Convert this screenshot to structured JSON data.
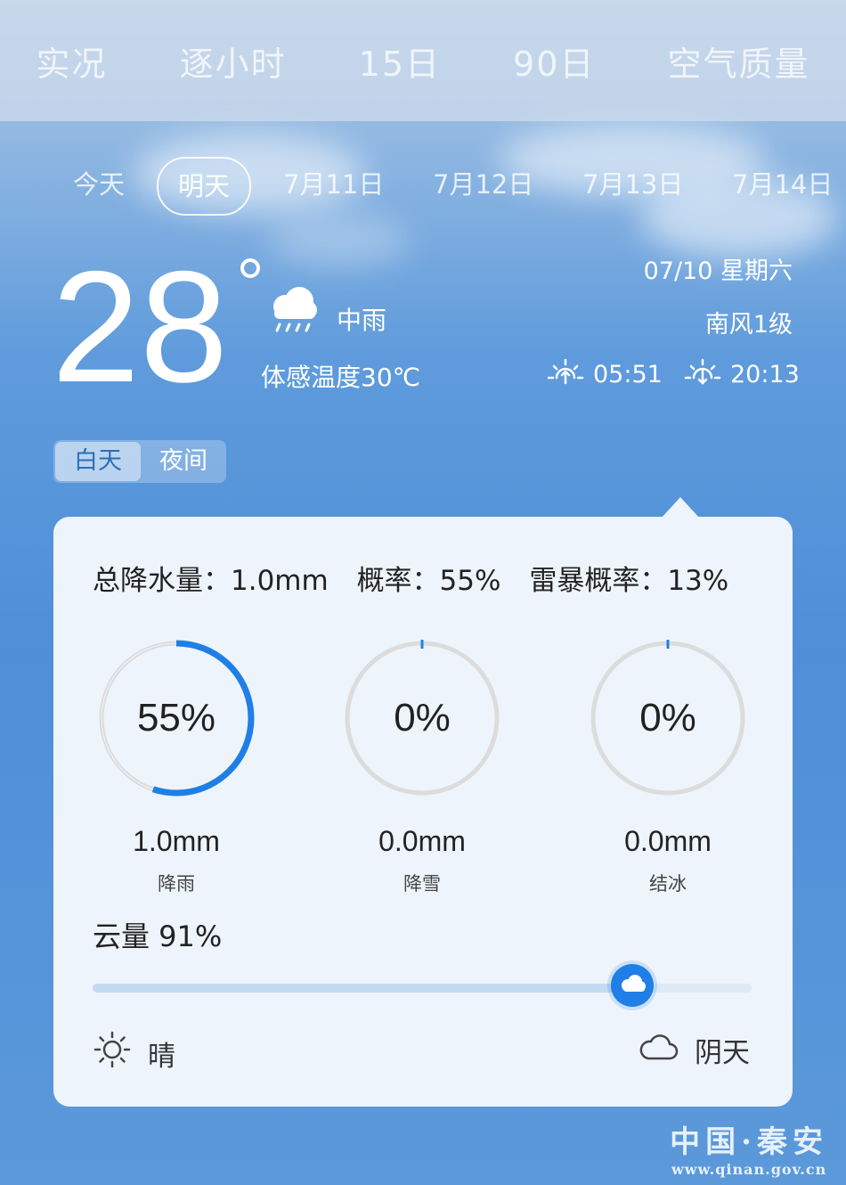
{
  "top_tabs": [
    "实况",
    "逐小时",
    "15日",
    "90日",
    "空气质量"
  ],
  "day_tabs": [
    "今天",
    "明天",
    "7月11日",
    "7月12日",
    "7月13日",
    "7月14日"
  ],
  "selected_day_index": 1,
  "current": {
    "temperature": "28",
    "condition": "中雨",
    "feels_like": "体感温度30℃",
    "date": "07/10 星期六",
    "wind": "南风1级",
    "sunrise": "05:51",
    "sunset": "20:13"
  },
  "segment": {
    "day": "白天",
    "night": "夜间",
    "selected": "day"
  },
  "card": {
    "total_precip": "总降水量：1.0mm",
    "probability": "概率：55%",
    "thunder_probability": "雷暴概率：13%",
    "rings": [
      {
        "percent_text": "55%",
        "percent": 55,
        "amount": "1.0mm",
        "label": "降雨"
      },
      {
        "percent_text": "0%",
        "percent": 0,
        "amount": "0.0mm",
        "label": "降雪"
      },
      {
        "percent_text": "0%",
        "percent": 0,
        "amount": "0.0mm",
        "label": "结冰"
      }
    ],
    "cloud_cover_label": "云量 91%",
    "cloud_cover_value": 91,
    "left_end_label": "晴",
    "right_end_label": "阴天"
  },
  "watermark": {
    "title": "中国·秦安",
    "url": "www.qinan.gov.cn"
  },
  "colors": {
    "accent": "#1f7fe6",
    "ring_track": "#dcdcdc",
    "card_bg": "#eef4fb"
  }
}
